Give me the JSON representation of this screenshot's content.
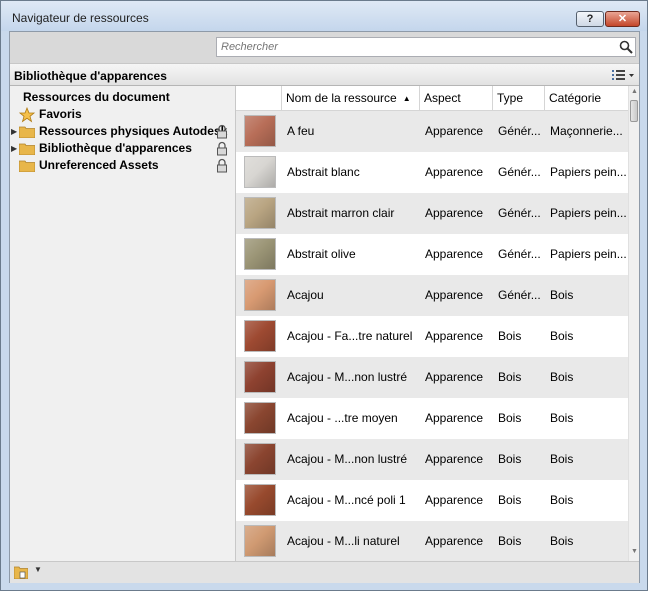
{
  "window": {
    "title": "Navigateur de ressources",
    "help_label": "?",
    "close_label": "✕"
  },
  "search": {
    "placeholder": "Rechercher"
  },
  "library": {
    "title": "Bibliothèque d'apparences"
  },
  "tree": {
    "header": "Ressources du document",
    "items": [
      {
        "label": "Favoris",
        "icon": "star-icon",
        "locked": false
      },
      {
        "label": "Ressources physiques Autodesk",
        "icon": "folder-icon",
        "locked": true
      },
      {
        "label": "Bibliothèque d'apparences",
        "icon": "folder-icon",
        "locked": true
      },
      {
        "label": "Unreferenced Assets",
        "icon": "folder-icon",
        "locked": true
      }
    ]
  },
  "table": {
    "columns": [
      "Nom de la ressource",
      "Aspect",
      "Type",
      "Catégorie"
    ],
    "sort_indicator": "▲",
    "rows": [
      {
        "name": "A feu",
        "aspect": "Apparence",
        "type": "Génér...",
        "category": "Maçonnerie...",
        "swatch": "#b86e58"
      },
      {
        "name": "Abstrait blanc",
        "aspect": "Apparence",
        "type": "Génér...",
        "category": "Papiers pein...",
        "swatch": "#d8d6d2"
      },
      {
        "name": "Abstrait marron clair",
        "aspect": "Apparence",
        "type": "Génér...",
        "category": "Papiers pein...",
        "swatch": "#b9a582"
      },
      {
        "name": "Abstrait olive",
        "aspect": "Apparence",
        "type": "Génér...",
        "category": "Papiers pein...",
        "swatch": "#9b9576"
      },
      {
        "name": "Acajou",
        "aspect": "Apparence",
        "type": "Génér...",
        "category": "Bois",
        "swatch": "#d89a72"
      },
      {
        "name": "Acajou - Fa...tre naturel",
        "aspect": "Apparence",
        "type": "Bois",
        "category": "Bois",
        "swatch": "#9e4a32"
      },
      {
        "name": "Acajou - M...non lustré",
        "aspect": "Apparence",
        "type": "Bois",
        "category": "Bois",
        "swatch": "#8e4230"
      },
      {
        "name": "Acajou - ...tre moyen",
        "aspect": "Apparence",
        "type": "Bois",
        "category": "Bois",
        "swatch": "#8a4630"
      },
      {
        "name": "Acajou - M...non lustré",
        "aspect": "Apparence",
        "type": "Bois",
        "category": "Bois",
        "swatch": "#8b4530"
      },
      {
        "name": "Acajou - M...ncé poli 1",
        "aspect": "Apparence",
        "type": "Bois",
        "category": "Bois",
        "swatch": "#984a2e"
      },
      {
        "name": "Acajou - M...li naturel",
        "aspect": "Apparence",
        "type": "Bois",
        "category": "Bois",
        "swatch": "#d09a72"
      }
    ]
  }
}
